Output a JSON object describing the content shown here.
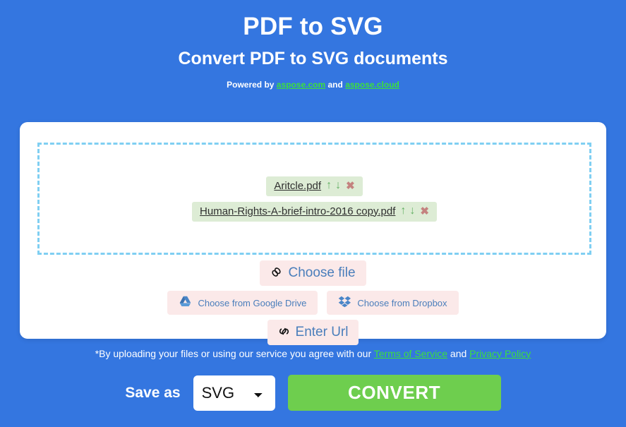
{
  "header": {
    "title": "PDF to SVG",
    "subtitle": "Convert PDF to SVG documents",
    "powered_prefix": "Powered by ",
    "powered_link1": "aspose.com",
    "powered_middle": " and ",
    "powered_link2": "aspose.cloud"
  },
  "dropzone": {
    "files": [
      {
        "name": "Aritcle.pdf",
        "move_up_icon": "arrow-up-icon",
        "move_down_icon": "arrow-down-icon",
        "remove_icon": "remove-icon",
        "move_up_glyph": "↑",
        "move_down_glyph": "↓",
        "remove_glyph": "✖"
      },
      {
        "name": "Human-Rights-A-brief-intro-2016 copy.pdf",
        "move_up_icon": "arrow-up-icon",
        "move_down_icon": "arrow-down-icon",
        "remove_icon": "remove-icon",
        "move_up_glyph": "↑",
        "move_down_glyph": "↓",
        "remove_glyph": "✖"
      }
    ]
  },
  "sources": {
    "choose_file": {
      "label": "Choose file",
      "icon": "paperclip-icon",
      "glyph": "🖇"
    },
    "google_drive": {
      "label": "Choose from Google Drive",
      "icon": "google-drive-icon"
    },
    "dropbox": {
      "label": "Choose from Dropbox",
      "icon": "dropbox-icon"
    },
    "enter_url": {
      "label": "Enter Url",
      "icon": "link-icon",
      "glyph": "🔗"
    }
  },
  "disclaimer": {
    "prefix": "*By uploading your files or using our service you agree with our ",
    "terms_link": "Terms of Service",
    "middle": " and ",
    "privacy_link": "Privacy Policy"
  },
  "convert": {
    "save_as_label": "Save as",
    "selected_format": "SVG",
    "format_options": [
      "SVG"
    ],
    "button_label": "CONVERT"
  },
  "colors": {
    "background_blue": "#3476e0",
    "link_green": "#3ce03c",
    "convert_green": "#6ece4e",
    "file_chip_green": "#ddecd5",
    "source_button_pink": "#fbe9e9",
    "dropzone_border_blue": "#80cff2",
    "source_label_blue": "#4a7ebb"
  }
}
